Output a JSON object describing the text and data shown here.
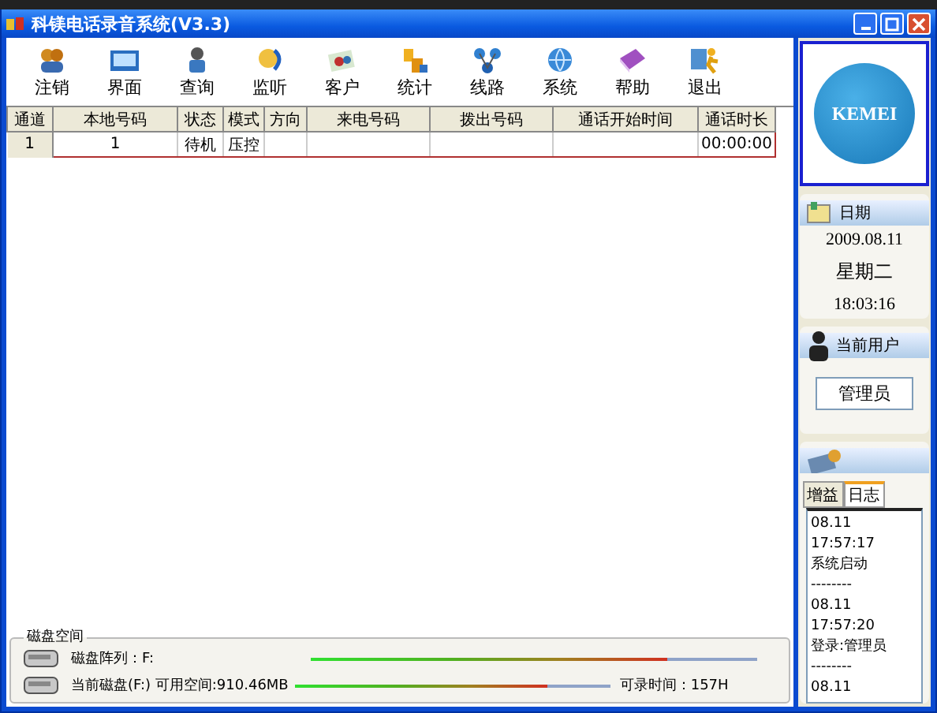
{
  "window": {
    "title": "科镁电话录音系统(V3.3)"
  },
  "toolbar": [
    {
      "label": "注销"
    },
    {
      "label": "界面"
    },
    {
      "label": "查询"
    },
    {
      "label": "监听"
    },
    {
      "label": "客户"
    },
    {
      "label": "统计"
    },
    {
      "label": "线路"
    },
    {
      "label": "系统"
    },
    {
      "label": "帮助"
    },
    {
      "label": "退出"
    }
  ],
  "table": {
    "columns": [
      "通道",
      "本地号码",
      "状态",
      "模式",
      "方向",
      "来电号码",
      "拨出号码",
      "通话开始时间",
      "通话时长"
    ],
    "rows": [
      {
        "selected": true,
        "cells": [
          "1",
          "1",
          "待机",
          "压控",
          "",
          "",
          "",
          "",
          "00:00:00"
        ]
      }
    ]
  },
  "logo": {
    "text": "KEMEI"
  },
  "date_panel": {
    "title": "日期",
    "date": "2009.08.11",
    "weekday": "星期二",
    "time": "18:03:16"
  },
  "user_panel": {
    "title": "当前用户",
    "user": "管理员"
  },
  "log_panel": {
    "tabs": [
      {
        "label": "增益",
        "selected": false
      },
      {
        "label": "日志",
        "selected": true
      }
    ],
    "lines": [
      "08.11",
      "17:57:17",
      "系统启动",
      "--------",
      "08.11",
      "17:57:20",
      "登录:管理员",
      "--------",
      "08.11"
    ]
  },
  "disk_panel": {
    "title": "磁盘空间",
    "rows": [
      {
        "label": "磁盘阵列：F:",
        "level": 0.8
      },
      {
        "label": "当前磁盘(F:) 可用空间:910.46MB",
        "level": 0.8,
        "extra": "可录时间：157H"
      }
    ]
  }
}
